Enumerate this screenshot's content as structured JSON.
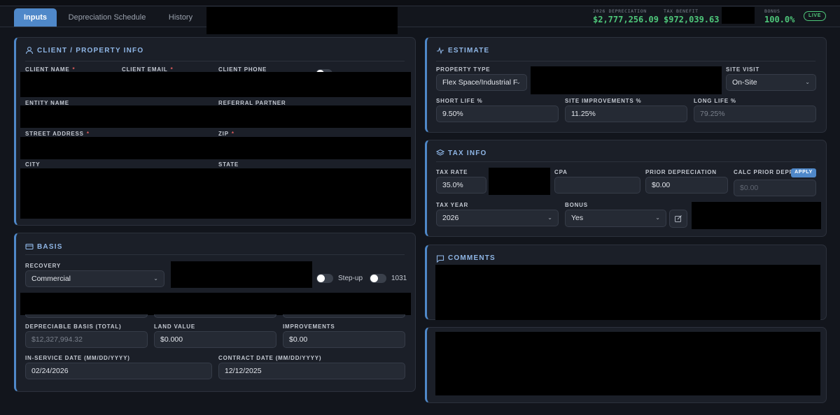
{
  "tabs": [
    {
      "label": "Inputs",
      "active": true
    },
    {
      "label": "Depreciation Schedule",
      "active": false
    },
    {
      "label": "History",
      "active": false
    }
  ],
  "header_stats": {
    "depreciation": {
      "label": "2026 DEPRECIATION",
      "value": "$2,777,256.09"
    },
    "tax_benefit": {
      "label": "TAX BENEFIT",
      "value": "$972,039.63"
    },
    "bonus": {
      "label": "BONUS",
      "value": "100.0%"
    },
    "live_badge": "LIVE"
  },
  "client": {
    "title": "CLIENT / PROPERTY INFO",
    "client_name_label": "CLIENT NAME",
    "client_email_label": "CLIENT EMAIL",
    "client_phone_label": "CLIENT PHONE",
    "entity_name_label": "ENTITY NAME",
    "referral_partner_label": "REFERRAL PARTNER",
    "street_address_label": "STREET ADDRESS",
    "zip_label": "ZIP",
    "city_label": "CITY",
    "state_label": "STATE",
    "required_mark": "*"
  },
  "basis": {
    "title": "BASIS",
    "recovery_label": "RECOVERY",
    "recovery_value": "Commercial",
    "stepup_label": "Step-up",
    "exchange_label": "1031",
    "depreciable_basis_label": "DEPRECIABLE BASIS (TOTAL)",
    "depreciable_basis_value": "$12,327,994.32",
    "land_value_label": "LAND VALUE",
    "land_value_value": "$0.000",
    "improvements_label": "IMPROVEMENTS",
    "improvements_value": "$0.00",
    "in_service_label": "IN-SERVICE DATE (MM/DD/YYYY)",
    "in_service_value": "02/24/2026",
    "contract_label": "CONTRACT DATE (MM/DD/YYYY)",
    "contract_value": "12/12/2025"
  },
  "estimate": {
    "title": "ESTIMATE",
    "property_type_label": "PROPERTY TYPE",
    "property_type_value": "Flex Space/Industrial F",
    "site_visit_label": "SITE VISIT",
    "site_visit_value": "On-Site",
    "short_life_label": "SHORT LIFE %",
    "short_life_value": "9.50%",
    "site_improvements_label": "SITE IMPROVEMENTS %",
    "site_improvements_value": "11.25%",
    "long_life_label": "LONG LIFE %",
    "long_life_value": "79.25%"
  },
  "tax_info": {
    "title": "TAX INFO",
    "tax_rate_label": "TAX RATE",
    "tax_rate_value": "35.0%",
    "cpa_label": "CPA",
    "cpa_value": "",
    "prior_depreciation_label": "PRIOR DEPRECIATION",
    "prior_depreciation_value": "$0.00",
    "calc_prior_label": "CALC PRIOR DEPR",
    "apply_label": "APPLY",
    "calc_prior_value": "$0.00",
    "tax_year_label": "TAX YEAR",
    "tax_year_value": "2026",
    "bonus_label": "BONUS",
    "bonus_value": "Yes"
  },
  "comments": {
    "title": "COMMENTS"
  },
  "colors": {
    "accent": "#4f88c9",
    "positive": "#4ec77a",
    "background": "#12151c",
    "panel": "#1b1f28",
    "required": "#e05d5d"
  },
  "icons": {
    "client": "user-icon",
    "basis": "card-icon",
    "estimate": "activity-icon",
    "tax_info": "layers-icon",
    "comments": "message-icon"
  }
}
